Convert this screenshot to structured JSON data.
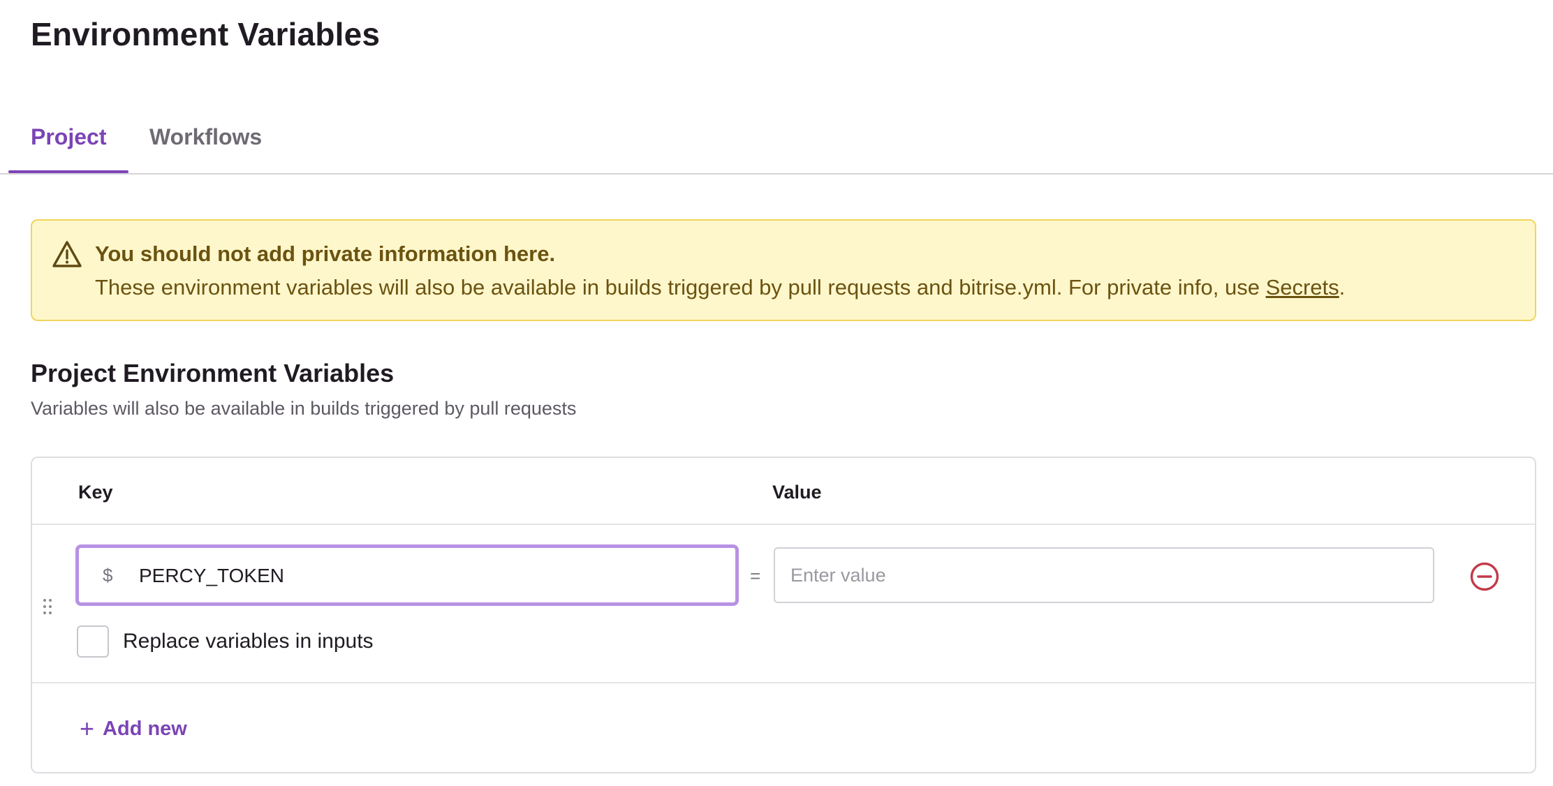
{
  "page": {
    "title": "Environment Variables"
  },
  "tabs": [
    {
      "label": "Project",
      "active": true
    },
    {
      "label": "Workflows",
      "active": false
    }
  ],
  "notice": {
    "title": "You should not add private information here.",
    "body": "These environment variables will also be available in builds triggered by pull requests and bitrise.yml. For private info, use ",
    "link_label": "Secrets",
    "trailing": ".",
    "icon": "warning-triangle-icon"
  },
  "section": {
    "title": "Project Environment Variables",
    "subtitle": "Variables will also be available in builds triggered by pull requests"
  },
  "table": {
    "headers": {
      "key": "Key",
      "value": "Value"
    },
    "rows": [
      {
        "prefix": "$",
        "key": "PERCY_TOKEN",
        "separator": "=",
        "value": "",
        "value_placeholder": "Enter value",
        "replace_label": "Replace variables in inputs",
        "replace_checked": false
      }
    ],
    "add_label": "Add new"
  },
  "colors": {
    "accent": "#7b44b5",
    "warning_bg": "#fff7cc",
    "warning_text": "#6b5310",
    "danger": "#c23a48"
  }
}
